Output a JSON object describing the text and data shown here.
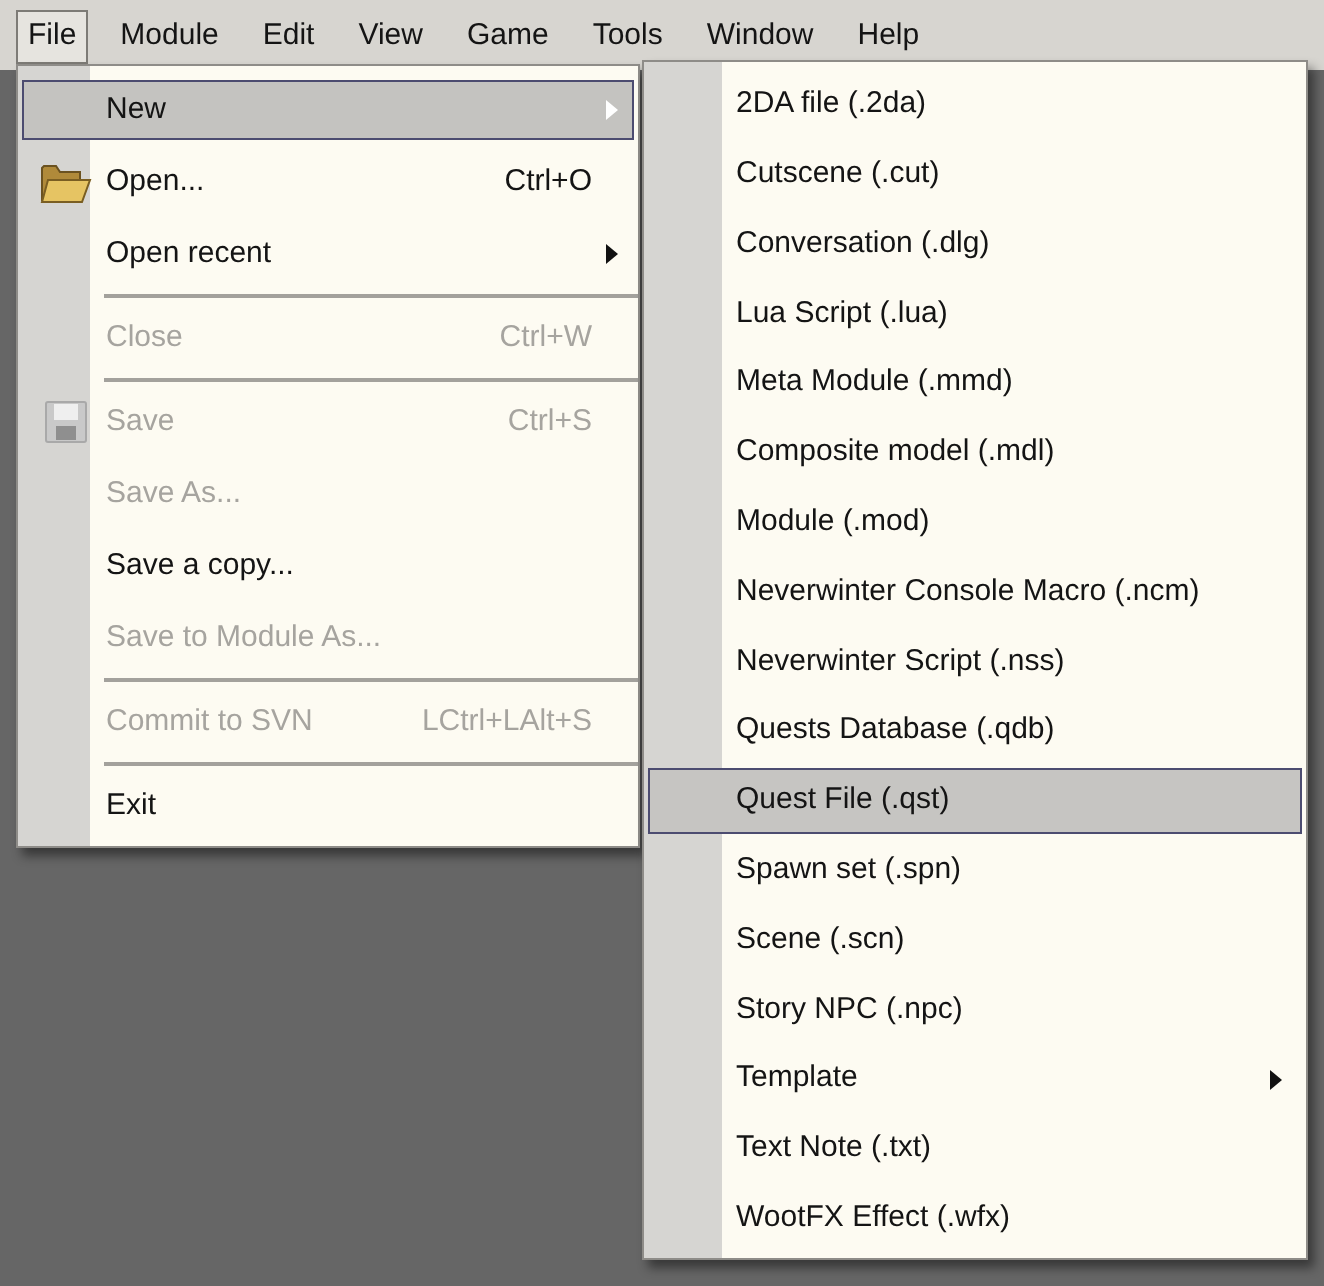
{
  "menubar": {
    "items": [
      {
        "label": "File",
        "selected": true
      },
      {
        "label": "Module",
        "selected": false
      },
      {
        "label": "Edit",
        "selected": false
      },
      {
        "label": "View",
        "selected": false
      },
      {
        "label": "Game",
        "selected": false
      },
      {
        "label": "Tools",
        "selected": false
      },
      {
        "label": "Window",
        "selected": false
      },
      {
        "label": "Help",
        "selected": false
      }
    ]
  },
  "file_menu": {
    "items": [
      {
        "kind": "item",
        "label": "New",
        "selected": true,
        "disabled": false,
        "submenu": true
      },
      {
        "kind": "item",
        "label": "Open...",
        "shortcut": "Ctrl+O",
        "selected": false,
        "disabled": false,
        "submenu": false
      },
      {
        "kind": "item",
        "label": "Open recent",
        "selected": false,
        "disabled": false,
        "submenu": true
      },
      {
        "kind": "separator"
      },
      {
        "kind": "item",
        "label": "Close",
        "shortcut": "Ctrl+W",
        "selected": false,
        "disabled": true,
        "submenu": false
      },
      {
        "kind": "separator"
      },
      {
        "kind": "item",
        "label": "Save",
        "shortcut": "Ctrl+S",
        "selected": false,
        "disabled": true,
        "submenu": false
      },
      {
        "kind": "item",
        "label": "Save As...",
        "selected": false,
        "disabled": true,
        "submenu": false
      },
      {
        "kind": "item",
        "label": "Save a copy...",
        "selected": false,
        "disabled": false,
        "submenu": false
      },
      {
        "kind": "item",
        "label": "Save to Module As...",
        "selected": false,
        "disabled": true,
        "submenu": false
      },
      {
        "kind": "separator"
      },
      {
        "kind": "item",
        "label": "Commit to SVN",
        "shortcut": "LCtrl+LAlt+S",
        "selected": false,
        "disabled": true,
        "submenu": false
      },
      {
        "kind": "separator"
      },
      {
        "kind": "item",
        "label": "Exit",
        "selected": false,
        "disabled": false,
        "submenu": false
      }
    ]
  },
  "new_submenu": {
    "items": [
      {
        "label": "2DA file (.2da)",
        "selected": false,
        "submenu": false
      },
      {
        "label": "Cutscene (.cut)",
        "selected": false,
        "submenu": false
      },
      {
        "label": "Conversation (.dlg)",
        "selected": false,
        "submenu": false
      },
      {
        "label": "Lua Script (.lua)",
        "selected": false,
        "submenu": false
      },
      {
        "label": "Meta Module (.mmd)",
        "selected": false,
        "submenu": false
      },
      {
        "label": "Composite model (.mdl)",
        "selected": false,
        "submenu": false
      },
      {
        "label": "Module (.mod)",
        "selected": false,
        "submenu": false
      },
      {
        "label": "Neverwinter Console Macro (.ncm)",
        "selected": false,
        "submenu": false
      },
      {
        "label": "Neverwinter Script (.nss)",
        "selected": false,
        "submenu": false
      },
      {
        "label": "Quests Database (.qdb)",
        "selected": false,
        "submenu": false
      },
      {
        "label": "Quest File (.qst)",
        "selected": true,
        "submenu": false
      },
      {
        "label": "Spawn set (.spn)",
        "selected": false,
        "submenu": false
      },
      {
        "label": "Scene (.scn)",
        "selected": false,
        "submenu": false
      },
      {
        "label": "Story NPC (.npc)",
        "selected": false,
        "submenu": false
      },
      {
        "label": "Template",
        "selected": false,
        "submenu": true
      },
      {
        "label": "Text Note (.txt)",
        "selected": false,
        "submenu": false
      },
      {
        "label": "WootFX Effect (.wfx)",
        "selected": false,
        "submenu": false
      }
    ]
  }
}
